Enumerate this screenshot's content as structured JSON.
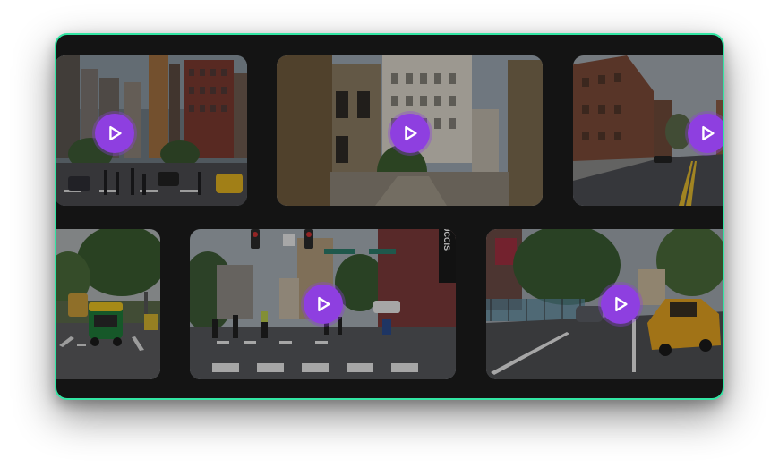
{
  "gallery": {
    "accent_border": "#33e6a4",
    "play_color": "#8e3fe0",
    "tiles": [
      {
        "scene": "city-avenue-crowd",
        "icon": "play-icon"
      },
      {
        "scene": "brick-alley",
        "icon": "play-icon"
      },
      {
        "scene": "empty-road-brick-building",
        "icon": "play-icon"
      },
      {
        "scene": "auto-rickshaw-street",
        "icon": "play-icon"
      },
      {
        "scene": "crosswalk-cyclists",
        "icon": "play-icon"
      },
      {
        "scene": "road-yellow-taxi",
        "icon": "play-icon"
      }
    ]
  },
  "signs": {
    "vertical_sign": "UCCIS"
  }
}
